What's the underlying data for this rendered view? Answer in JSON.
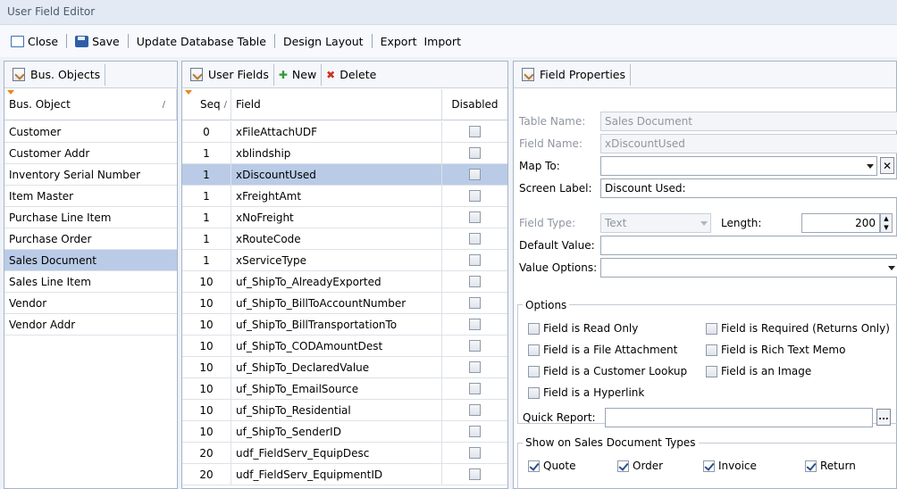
{
  "window": {
    "title": "User Field Editor"
  },
  "toolbar": {
    "close": "Close",
    "save": "Save",
    "update": "Update Database Table",
    "design": "Design Layout",
    "export": "Export",
    "import": "Import"
  },
  "bus_objects": {
    "tab": "Bus. Objects",
    "column": "Bus. Object",
    "items": [
      "Customer",
      "Customer Addr",
      "Inventory Serial Number",
      "Item Master",
      "Purchase Line Item",
      "Purchase Order",
      "Sales Document",
      "Sales Line Item",
      "Vendor",
      "Vendor Addr"
    ],
    "selected_index": 6
  },
  "user_fields": {
    "tab": "User Fields",
    "new": "New",
    "delete": "Delete",
    "col_seq": "Seq",
    "col_field": "Field",
    "col_disabled": "Disabled",
    "rows": [
      {
        "seq": "0",
        "field": "xFileAttachUDF"
      },
      {
        "seq": "1",
        "field": "xblindship"
      },
      {
        "seq": "1",
        "field": "xDiscountUsed"
      },
      {
        "seq": "1",
        "field": "xFreightAmt"
      },
      {
        "seq": "1",
        "field": "xNoFreight"
      },
      {
        "seq": "1",
        "field": "xRouteCode"
      },
      {
        "seq": "1",
        "field": "xServiceType"
      },
      {
        "seq": "10",
        "field": "uf_ShipTo_AlreadyExported"
      },
      {
        "seq": "10",
        "field": "uf_ShipTo_BillToAccountNumber"
      },
      {
        "seq": "10",
        "field": "uf_ShipTo_BillTransportationTo"
      },
      {
        "seq": "10",
        "field": "uf_ShipTo_CODAmountDest"
      },
      {
        "seq": "10",
        "field": "uf_ShipTo_DeclaredValue"
      },
      {
        "seq": "10",
        "field": "uf_ShipTo_EmailSource"
      },
      {
        "seq": "10",
        "field": "uf_ShipTo_Residential"
      },
      {
        "seq": "10",
        "field": "uf_ShipTo_SenderID"
      },
      {
        "seq": "20",
        "field": "udf_FieldServ_EquipDesc"
      },
      {
        "seq": "20",
        "field": "udf_FieldServ_EquipmentID"
      }
    ],
    "selected_index": 2
  },
  "props": {
    "tab": "Field Properties",
    "table_name_label": "Table Name:",
    "table_name": "Sales Document",
    "field_name_label": "Field Name:",
    "field_name": "xDiscountUsed",
    "map_to_label": "Map To:",
    "map_to": "",
    "screen_label_label": "Screen Label:",
    "screen_label": "Discount Used:",
    "field_type_label": "Field Type:",
    "field_type": "Text",
    "length_label": "Length:",
    "length": "200",
    "default_label": "Default Value:",
    "default": "",
    "value_options_label": "Value Options:",
    "value_options": "",
    "options_title": "Options",
    "options": {
      "read_only": "Field is Read Only",
      "required": "Field is Required (Returns Only)",
      "file_attach": "Field is a File Attachment",
      "rich_text": "Field is Rich Text Memo",
      "customer_lookup": "Field is a Customer Lookup",
      "image": "Field is an Image",
      "hyperlink": "Field is a Hyperlink"
    },
    "quick_report_label": "Quick Report:",
    "quick_report": "",
    "ellipsis": "...",
    "show_title": "Show on Sales Document Types",
    "types": {
      "quote": "Quote",
      "order": "Order",
      "invoice": "Invoice",
      "return": "Return"
    }
  }
}
